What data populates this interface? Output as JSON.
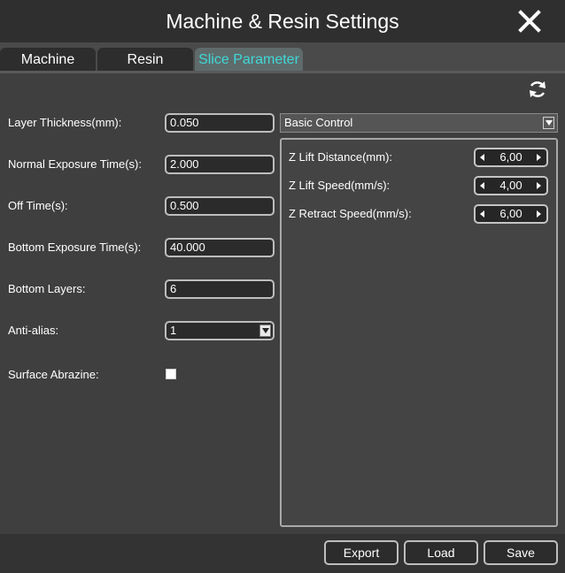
{
  "window": {
    "title": "Machine & Resin Settings"
  },
  "tabs": [
    {
      "label": "Machine",
      "active": false
    },
    {
      "label": "Resin",
      "active": false
    },
    {
      "label": "Slice Parameter",
      "active": true
    }
  ],
  "params": {
    "layer_thickness": {
      "label": "Layer Thickness(mm):",
      "value": "0.050"
    },
    "normal_exposure": {
      "label": "Normal Exposure Time(s):",
      "value": "2.000"
    },
    "off_time": {
      "label": "Off Time(s):",
      "value": "0.500"
    },
    "bottom_exposure": {
      "label": "Bottom Exposure Time(s):",
      "value": "40.000"
    },
    "bottom_layers": {
      "label": "Bottom Layers:",
      "value": "6"
    },
    "anti_alias": {
      "label": "Anti-alias:",
      "value": "1"
    },
    "surface_abrazine": {
      "label": "Surface Abrazine:",
      "checked": false
    }
  },
  "control": {
    "mode": "Basic Control",
    "z_lift_distance": {
      "label": "Z Lift Distance(mm):",
      "value": "6,00"
    },
    "z_lift_speed": {
      "label": "Z Lift Speed(mm/s):",
      "value": "4,00"
    },
    "z_retract_speed": {
      "label": "Z Retract Speed(mm/s):",
      "value": "6,00"
    }
  },
  "footer": {
    "export_label": "Export",
    "load_label": "Load",
    "save_label": "Save"
  },
  "colors": {
    "active_tab_text": "#3fd8d8",
    "background": "#3c3c3c"
  },
  "icons": {
    "close": "close-icon",
    "refresh": "refresh-icon"
  }
}
